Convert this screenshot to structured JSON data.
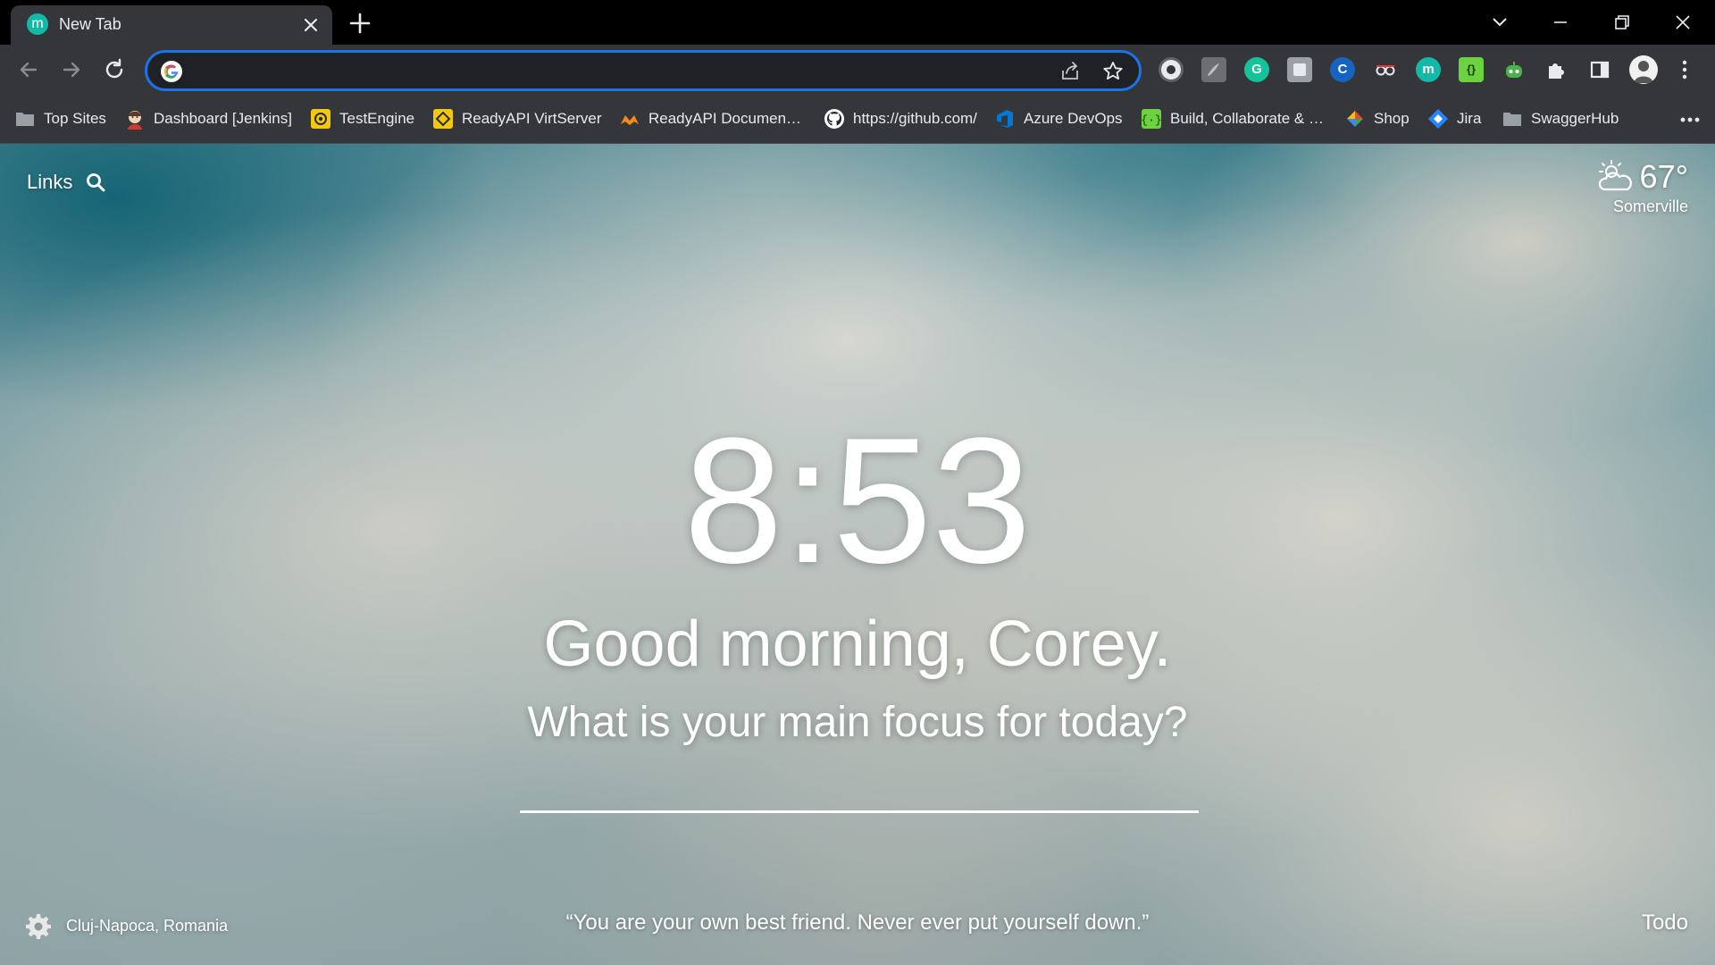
{
  "tab": {
    "title": "New Tab",
    "favicon_letter": "m"
  },
  "omnibox": {
    "value": "",
    "placeholder": ""
  },
  "bookmarks": [
    {
      "label": "Top Sites",
      "icon": "folder-icon"
    },
    {
      "label": "Dashboard [Jenkins]",
      "icon": "jenkins-icon"
    },
    {
      "label": "TestEngine",
      "icon": "testengine-icon"
    },
    {
      "label": "ReadyAPI VirtServer",
      "icon": "virtserver-icon"
    },
    {
      "label": "ReadyAPI Documen…",
      "icon": "readyapi-docs-icon"
    },
    {
      "label": "https://github.com/",
      "icon": "github-icon"
    },
    {
      "label": "Azure DevOps",
      "icon": "azure-devops-icon"
    },
    {
      "label": "Build, Collaborate & …",
      "icon": "build-collaborate-icon"
    },
    {
      "label": "Shop",
      "icon": "shop-icon"
    },
    {
      "label": "Jira",
      "icon": "jira-icon"
    },
    {
      "label": "SwaggerHub",
      "icon": "folder-icon"
    }
  ],
  "extensions": [
    {
      "name": "extension-1-icon"
    },
    {
      "name": "extension-pdf-icon"
    },
    {
      "name": "grammarly-icon",
      "letter": "G"
    },
    {
      "name": "extension-blank-icon"
    },
    {
      "name": "extension-c-icon",
      "letter": "C"
    },
    {
      "name": "extension-glasses-icon"
    },
    {
      "name": "momentum-icon",
      "letter": "m"
    },
    {
      "name": "extension-braces-icon",
      "letter": "{}"
    },
    {
      "name": "extension-bot-icon"
    }
  ],
  "dashboard": {
    "links_label": "Links",
    "weather": {
      "temperature": "67°",
      "location": "Somerville",
      "icon": "partly-cloudy-icon"
    },
    "clock": "8:53",
    "greeting": "Good morning, Corey.",
    "focus_question": "What is your main focus for today?",
    "focus_value": "",
    "photo_location": "Cluj-Napoca, Romania",
    "quote": "“You are your own best friend. Never ever put yourself down.”",
    "todo_label": "Todo"
  },
  "colors": {
    "chrome_dark": "#35363a",
    "omnibox_focus": "#1a73e8",
    "momentum_teal": "#14b8a6"
  }
}
